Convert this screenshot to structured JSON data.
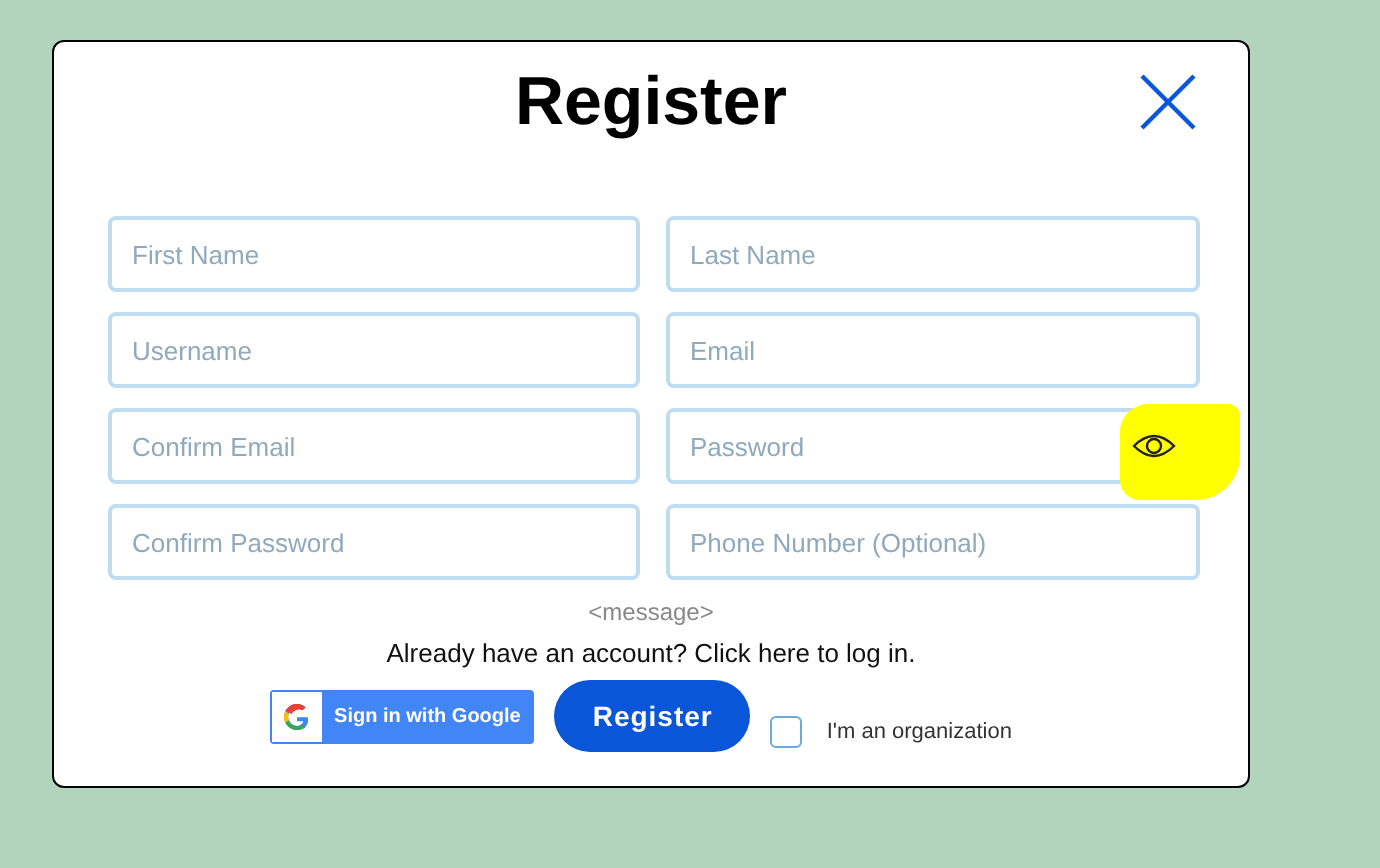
{
  "dialog": {
    "title": "Register"
  },
  "fields": [
    {
      "placeholder": "First Name",
      "kind": "text"
    },
    {
      "placeholder": "Last Name",
      "kind": "text"
    },
    {
      "placeholder": "Username",
      "kind": "text"
    },
    {
      "placeholder": "Email",
      "kind": "text"
    },
    {
      "placeholder": "Confirm Email",
      "kind": "text"
    },
    {
      "placeholder": "Password",
      "kind": "password"
    },
    {
      "placeholder": "Confirm Password",
      "kind": "text"
    },
    {
      "placeholder": "Phone Number (Optional)",
      "kind": "text"
    }
  ],
  "message": "<message>",
  "login_link": "Already have an account? Click here to log in.",
  "google_button": "Sign in with Google",
  "register_button": "Register",
  "organization": {
    "label": "I'm an organization",
    "checked": false
  }
}
